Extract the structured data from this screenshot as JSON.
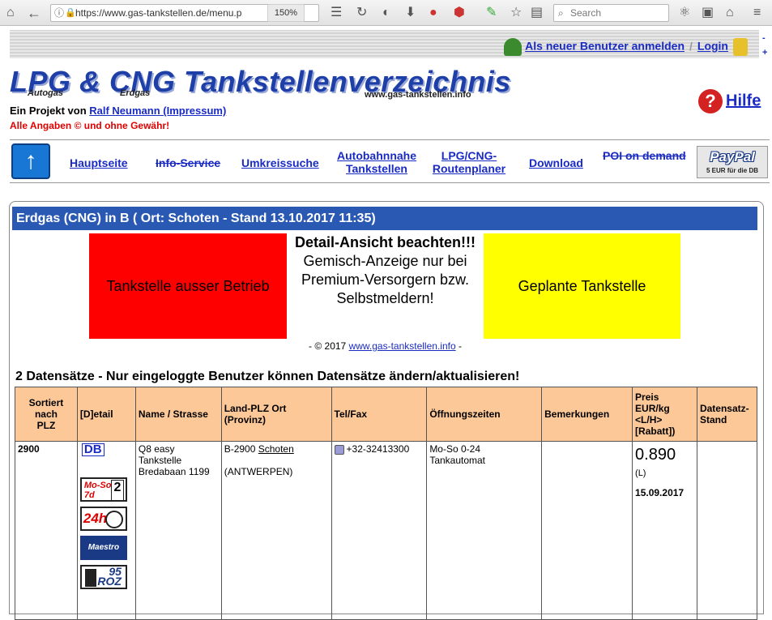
{
  "browser": {
    "url": "https://www.gas-tankstellen.de/menu.p",
    "zoom": "150%",
    "search_placeholder": "Search"
  },
  "header": {
    "register_link": "Als neuer Benutzer anmelden",
    "login_link": "Login",
    "side_dash": "-",
    "side_plus": "+",
    "logo_title": "LPG & CNG Tankstellenverzeichnis",
    "logo_autogas": "Autogas",
    "logo_erdgas": "Erdgas",
    "logo_url": "www.gas-tankstellen.info",
    "project_prefix": "Ein Projekt von ",
    "project_link": "Ralf Neumann (Impressum)",
    "disclaimer": "Alle Angaben © und ohne Gewähr!",
    "help_link": "Hilfe"
  },
  "nav": {
    "items": [
      {
        "label": "Hauptseite"
      },
      {
        "label": "Info-Service"
      },
      {
        "label": "Umkreissuche"
      },
      {
        "label_line1": "Autobahnnahe",
        "label_line2": "Tankstellen"
      },
      {
        "label_line1": "LPG/CNG-",
        "label_line2": "Routenplaner"
      },
      {
        "label": "Download"
      },
      {
        "label": "POI on demand"
      }
    ],
    "paypal_logo": "PayPal",
    "paypal_sub": "5 EUR für die DB"
  },
  "section": {
    "title": "Erdgas (CNG) in B ( Ort: Schoten - Stand 13.10.2017 11:35)"
  },
  "legend": {
    "out_of_service": "Tankstelle ausser Betrieb",
    "detail_bold": "Detail-Ansicht beachten!!!",
    "detail_text": " Gemisch-Anzeige nur bei Premium-Versorgern bzw. Selbstmeldern!",
    "planned": "Geplante Tankstelle",
    "copyright_prefix": "- © 2017 ",
    "copyright_link": "www.gas-tankstellen.info",
    "copyright_suffix": " -",
    "colors": {
      "out_of_service": "#ff0000",
      "planned": "#ffff00"
    }
  },
  "records": {
    "title": "2 Datensätze - Nur eingeloggte Benutzer können Datensätze ändern/aktualisieren!"
  },
  "table": {
    "headers": {
      "sorted_line1": "Sortiert",
      "sorted_line2": "nach",
      "sorted_line3": "PLZ",
      "detail": "[D]etail",
      "name": "Name / Strasse",
      "land_line1": "Land-PLZ Ort",
      "land_line2": "(Provinz)",
      "tel": "Tel/Fax",
      "hours": "Öffnungszeiten",
      "remarks": "Bemerkungen",
      "price_line1": "Preis",
      "price_line2": "EUR/kg",
      "price_line3": "<L/H>",
      "price_line4": "[Rabatt])",
      "status_line1": "Datensatz-",
      "status_line2": "Stand"
    },
    "rows": [
      {
        "plz": "2900",
        "detail_link": "DB",
        "badge_moso": "Mo-So",
        "badge_7d": "7d",
        "badge_2": "2",
        "badge_24h": "24h",
        "badge_maestro": "Maestro",
        "badge_95": "95",
        "badge_roz": "ROZ",
        "name_line1": "Q8 easy",
        "name_line2": "Tankstelle",
        "name_line3": "Bredabaan 1199",
        "land_prefix": "B-2900",
        "land_city": "Schoten",
        "province": "(ANTWERPEN)",
        "tel": "+32-32413300",
        "hours_line1": "Mo-So 0-24",
        "hours_line2": "Tankautomat",
        "remarks": "",
        "price": "0.890",
        "price_unit": "(L)",
        "price_date": "15.09.2017",
        "status": ""
      }
    ]
  }
}
